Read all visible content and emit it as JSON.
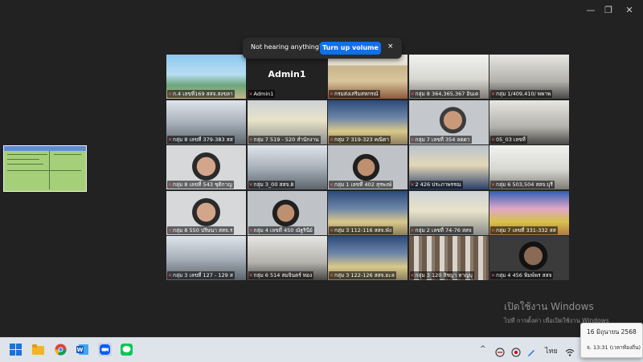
{
  "window": {
    "minimize": "—",
    "restore": "❐",
    "close": "✕"
  },
  "notice": {
    "message": "Not hearing anything?",
    "button": "Turn up volume",
    "close": "×"
  },
  "participants": [
    {
      "name": "ก.4 เลขที่169 สสจ.สงขลา",
      "scene": "beach"
    },
    {
      "name": "Admin1",
      "scene": "avatar",
      "big": "Admin1"
    },
    {
      "name": "กรมส่งเสริมสหกรณ์",
      "scene": "presenter",
      "active": true
    },
    {
      "name": "กลุ่ม 8 364,365,367 อินเต",
      "scene": "room"
    },
    {
      "name": "กลุ่ม 1/409,410/ พพาพ",
      "scene": "room2"
    },
    {
      "name": "กลุ่ม 8 เลขที่ 379-383 สส",
      "scene": "office"
    },
    {
      "name": "กลุ่ม 7 519 - 520 สำนักงาน",
      "scene": "office2"
    },
    {
      "name": "กลุ่ม 7 319-323 คณิตา",
      "scene": "meeting"
    },
    {
      "name": "กลุ่ม 7 เลขที่ 354 ลดดา",
      "scene": "face"
    },
    {
      "name": "05_03 เลขที่",
      "scene": "room2"
    },
    {
      "name": "กลุ่ม 8 เลขที่ 543 ชุติกาญ",
      "scene": "face2"
    },
    {
      "name": "กลุ่ม 3_00 สสจ.8",
      "scene": "office"
    },
    {
      "name": "กลุ่ม 1 เลขที่ 402 สุรพงษ์",
      "scene": "face3"
    },
    {
      "name": "2 426 ประภาพรรณ",
      "scene": "uniform"
    },
    {
      "name": "กลุ่ม 6 503,504 สสจ.บุรี",
      "scene": "room"
    },
    {
      "name": "กลุ่ม 8 550 ปริษนา สสจ.ร",
      "scene": "face2"
    },
    {
      "name": "กลุ่ม 4 เลขที่ 450 ณัฐรินีย์",
      "scene": "face3"
    },
    {
      "name": "กลุ่ม 3 112-116 สสจ.พัง",
      "scene": "meeting"
    },
    {
      "name": "กลุ่ม 2 เลขที่ 74-76 สสจ",
      "scene": "office2"
    },
    {
      "name": "กลุ่ม 7 เลขที่ 331-332 สส",
      "scene": "banner"
    },
    {
      "name": "กลุ่ม 3 เลขที่ 127 - 129 ส",
      "scene": "office"
    },
    {
      "name": "กลุ่ม 6 514 สมจินตร์ ทอง",
      "scene": "room2"
    },
    {
      "name": "กลุ่ม 3 122-126 สสจ.ยะล",
      "scene": "meeting"
    },
    {
      "name": "กลุ่ม 3 120 สิรญา หาญบุ",
      "scene": "shelves"
    },
    {
      "name": "กลุ่ม 4 456 พิมพ์พร สสจ",
      "scene": "face4"
    }
  ],
  "activation": {
    "line1": "เปิดใช้งาน Windows",
    "line2": "ไปที่ การตั้งค่า เพื่อเปิดใช้งาน Windows"
  },
  "tray": {
    "chevron": "^",
    "lang": "ไทย"
  },
  "clock_popup": {
    "date": "16 มิถุนายน 2568",
    "time": "จ. 13:31 (เวลาท้องถิ่น)"
  },
  "colors": {
    "accent": "#0e71eb",
    "active_border": "#2fc24b",
    "muted_mic": "#ff5a5a"
  }
}
